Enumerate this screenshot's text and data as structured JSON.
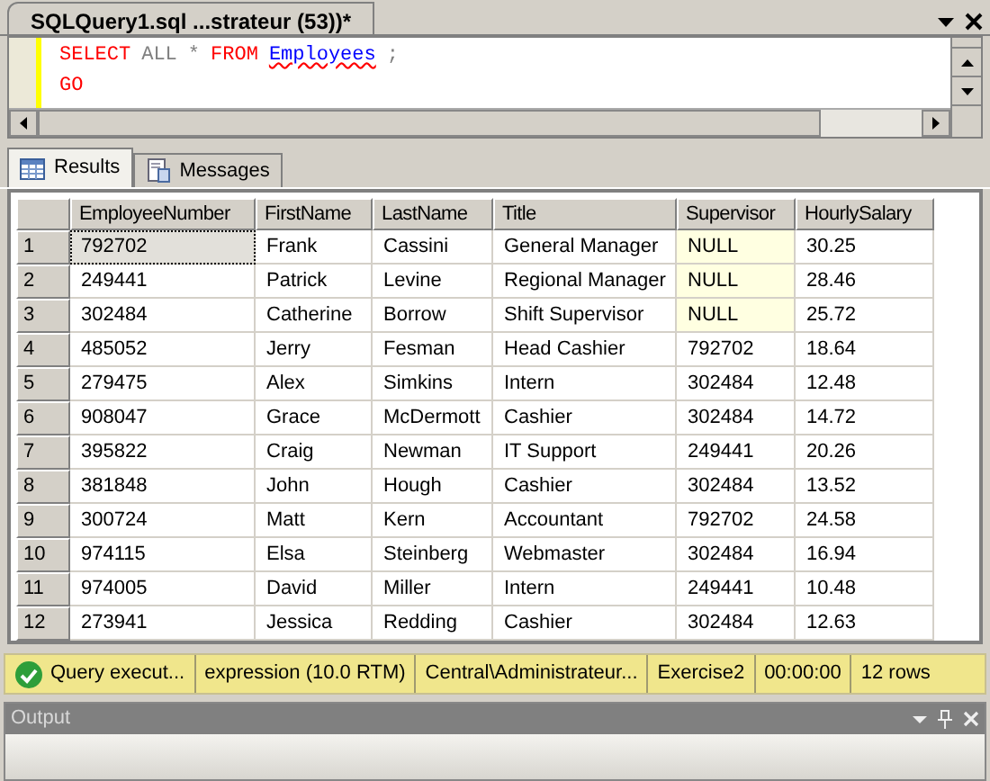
{
  "document_tab": {
    "title": "SQLQuery1.sql ...strateur (53))*",
    "selected": true
  },
  "editor": {
    "lines": [
      [
        {
          "text": "SELECT",
          "kind": "keyword"
        },
        {
          "text": "ALL",
          "kind": "operator"
        },
        {
          "text": "*",
          "kind": "operator"
        },
        {
          "text": "FROM",
          "kind": "keyword"
        },
        {
          "text": "Employees",
          "kind": "identifier"
        },
        {
          "text": ";",
          "kind": "operator"
        }
      ],
      [
        {
          "text": "GO",
          "kind": "keyword"
        }
      ]
    ]
  },
  "result_tabs": [
    {
      "label": "Results",
      "selected": true,
      "kind": "grid"
    },
    {
      "label": "Messages",
      "selected": false,
      "kind": "messages"
    }
  ],
  "table": {
    "columns": [
      "EmployeeNumber",
      "FirstName",
      "LastName",
      "Title",
      "Supervisor",
      "HourlySalary"
    ],
    "rows": [
      {
        "number": "1",
        "cells": [
          "792702",
          "Frank",
          "Cassini",
          "General Manager",
          "NULL",
          "30.25"
        ],
        "supervisor_null": true,
        "focused": true
      },
      {
        "number": "2",
        "cells": [
          "249441",
          "Patrick",
          "Levine",
          "Regional Manager",
          "NULL",
          "28.46"
        ],
        "supervisor_null": true,
        "focused": false
      },
      {
        "number": "3",
        "cells": [
          "302484",
          "Catherine",
          "Borrow",
          "Shift Supervisor",
          "NULL",
          "25.72"
        ],
        "supervisor_null": true,
        "focused": false
      },
      {
        "number": "4",
        "cells": [
          "485052",
          "Jerry",
          "Fesman",
          "Head Cashier",
          "792702",
          "18.64"
        ],
        "supervisor_null": false,
        "focused": false
      },
      {
        "number": "5",
        "cells": [
          "279475",
          "Alex",
          "Simkins",
          "Intern",
          "302484",
          "12.48"
        ],
        "supervisor_null": false,
        "focused": false
      },
      {
        "number": "6",
        "cells": [
          "908047",
          "Grace",
          "McDermott",
          "Cashier",
          "302484",
          "14.72"
        ],
        "supervisor_null": false,
        "focused": false
      },
      {
        "number": "7",
        "cells": [
          "395822",
          "Craig",
          "Newman",
          "IT Support",
          "249441",
          "20.26"
        ],
        "supervisor_null": false,
        "focused": false
      },
      {
        "number": "8",
        "cells": [
          "381848",
          "John",
          "Hough",
          "Cashier",
          "302484",
          "13.52"
        ],
        "supervisor_null": false,
        "focused": false
      },
      {
        "number": "9",
        "cells": [
          "300724",
          "Matt",
          "Kern",
          "Accountant",
          "792702",
          "24.58"
        ],
        "supervisor_null": false,
        "focused": false
      },
      {
        "number": "10",
        "cells": [
          "974115",
          "Elsa",
          "Steinberg",
          "Webmaster",
          "302484",
          "16.94"
        ],
        "supervisor_null": false,
        "focused": false
      },
      {
        "number": "11",
        "cells": [
          "974005",
          "David",
          "Miller",
          "Intern",
          "249441",
          "10.48"
        ],
        "supervisor_null": false,
        "focused": false
      },
      {
        "number": "12",
        "cells": [
          "273941",
          "Jessica",
          "Redding",
          "Cashier",
          "302484",
          "12.63"
        ],
        "supervisor_null": false,
        "focused": false
      }
    ]
  },
  "status_bar": [
    "Query execut...",
    "expression (10.0 RTM)",
    "Central\\Administrateur...",
    "Exercise2",
    "00:00:00",
    "12 rows"
  ],
  "output_panel": {
    "title": "Output"
  }
}
